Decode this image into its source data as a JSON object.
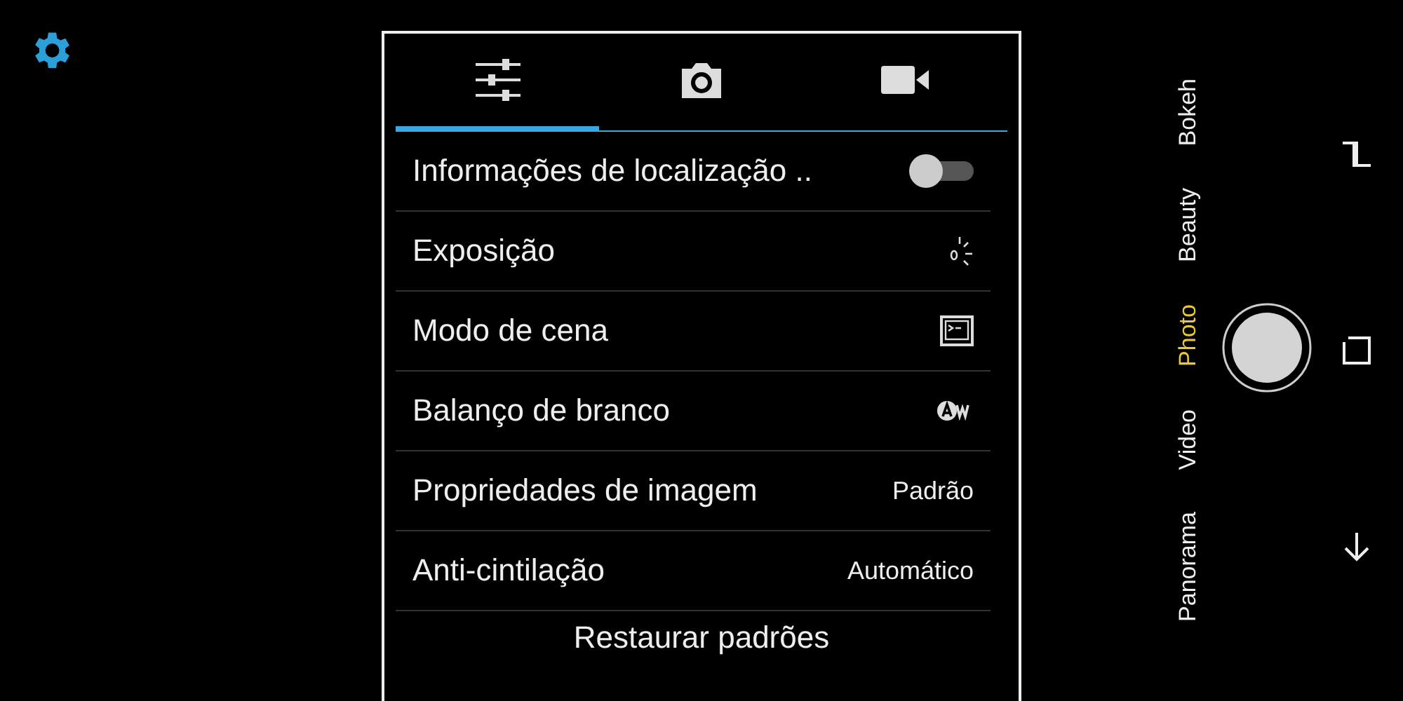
{
  "tabs": [
    {
      "selected": true
    },
    {
      "selected": false
    },
    {
      "selected": false
    }
  ],
  "settings": [
    {
      "kind": "toggle",
      "label": "Informações de localização ..",
      "on": false
    },
    {
      "kind": "icon",
      "label": "Exposição"
    },
    {
      "kind": "icon",
      "label": "Modo de cena"
    },
    {
      "kind": "icon",
      "label": "Balanço de branco"
    },
    {
      "kind": "value",
      "label": "Propriedades de imagem",
      "value": "Padrão"
    },
    {
      "kind": "value",
      "label": "Anti-cintilação",
      "value": "Automático"
    }
  ],
  "restore_button": "Restaurar padrões",
  "modes": [
    {
      "label": "Panorama",
      "selected": false
    },
    {
      "label": "Video",
      "selected": false
    },
    {
      "label": "Photo",
      "selected": true
    },
    {
      "label": "Beauty",
      "selected": false
    },
    {
      "label": "Bokeh",
      "selected": false
    }
  ]
}
